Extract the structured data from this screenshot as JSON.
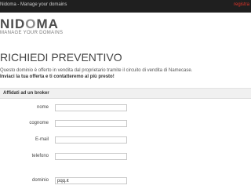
{
  "window": {
    "title": "Nidoma - Manage your domains",
    "top_link": "registra"
  },
  "logo": {
    "word_part1": "NID",
    "word_o": "O",
    "word_part2": "MA",
    "tagline": "MANAGE YOUR DOMAINS"
  },
  "page": {
    "title": "RICHIEDI PREVENTIVO",
    "description_line1": "Questo dominio è offerto in vendita dal proprietario tramite il circuito di vendita di Namecase.",
    "description_line2": "Inviaci la tua offerta e ti contatteremo al più presto!"
  },
  "form": {
    "section_title": "Affidati ad un broker",
    "fields": [
      {
        "label": "nome",
        "value": ""
      },
      {
        "label": "cognome",
        "value": ""
      },
      {
        "label": "E-mail",
        "value": ""
      },
      {
        "label": "telefono",
        "value": ""
      },
      {
        "label": "dominio",
        "value": "pqq.it"
      }
    ]
  }
}
